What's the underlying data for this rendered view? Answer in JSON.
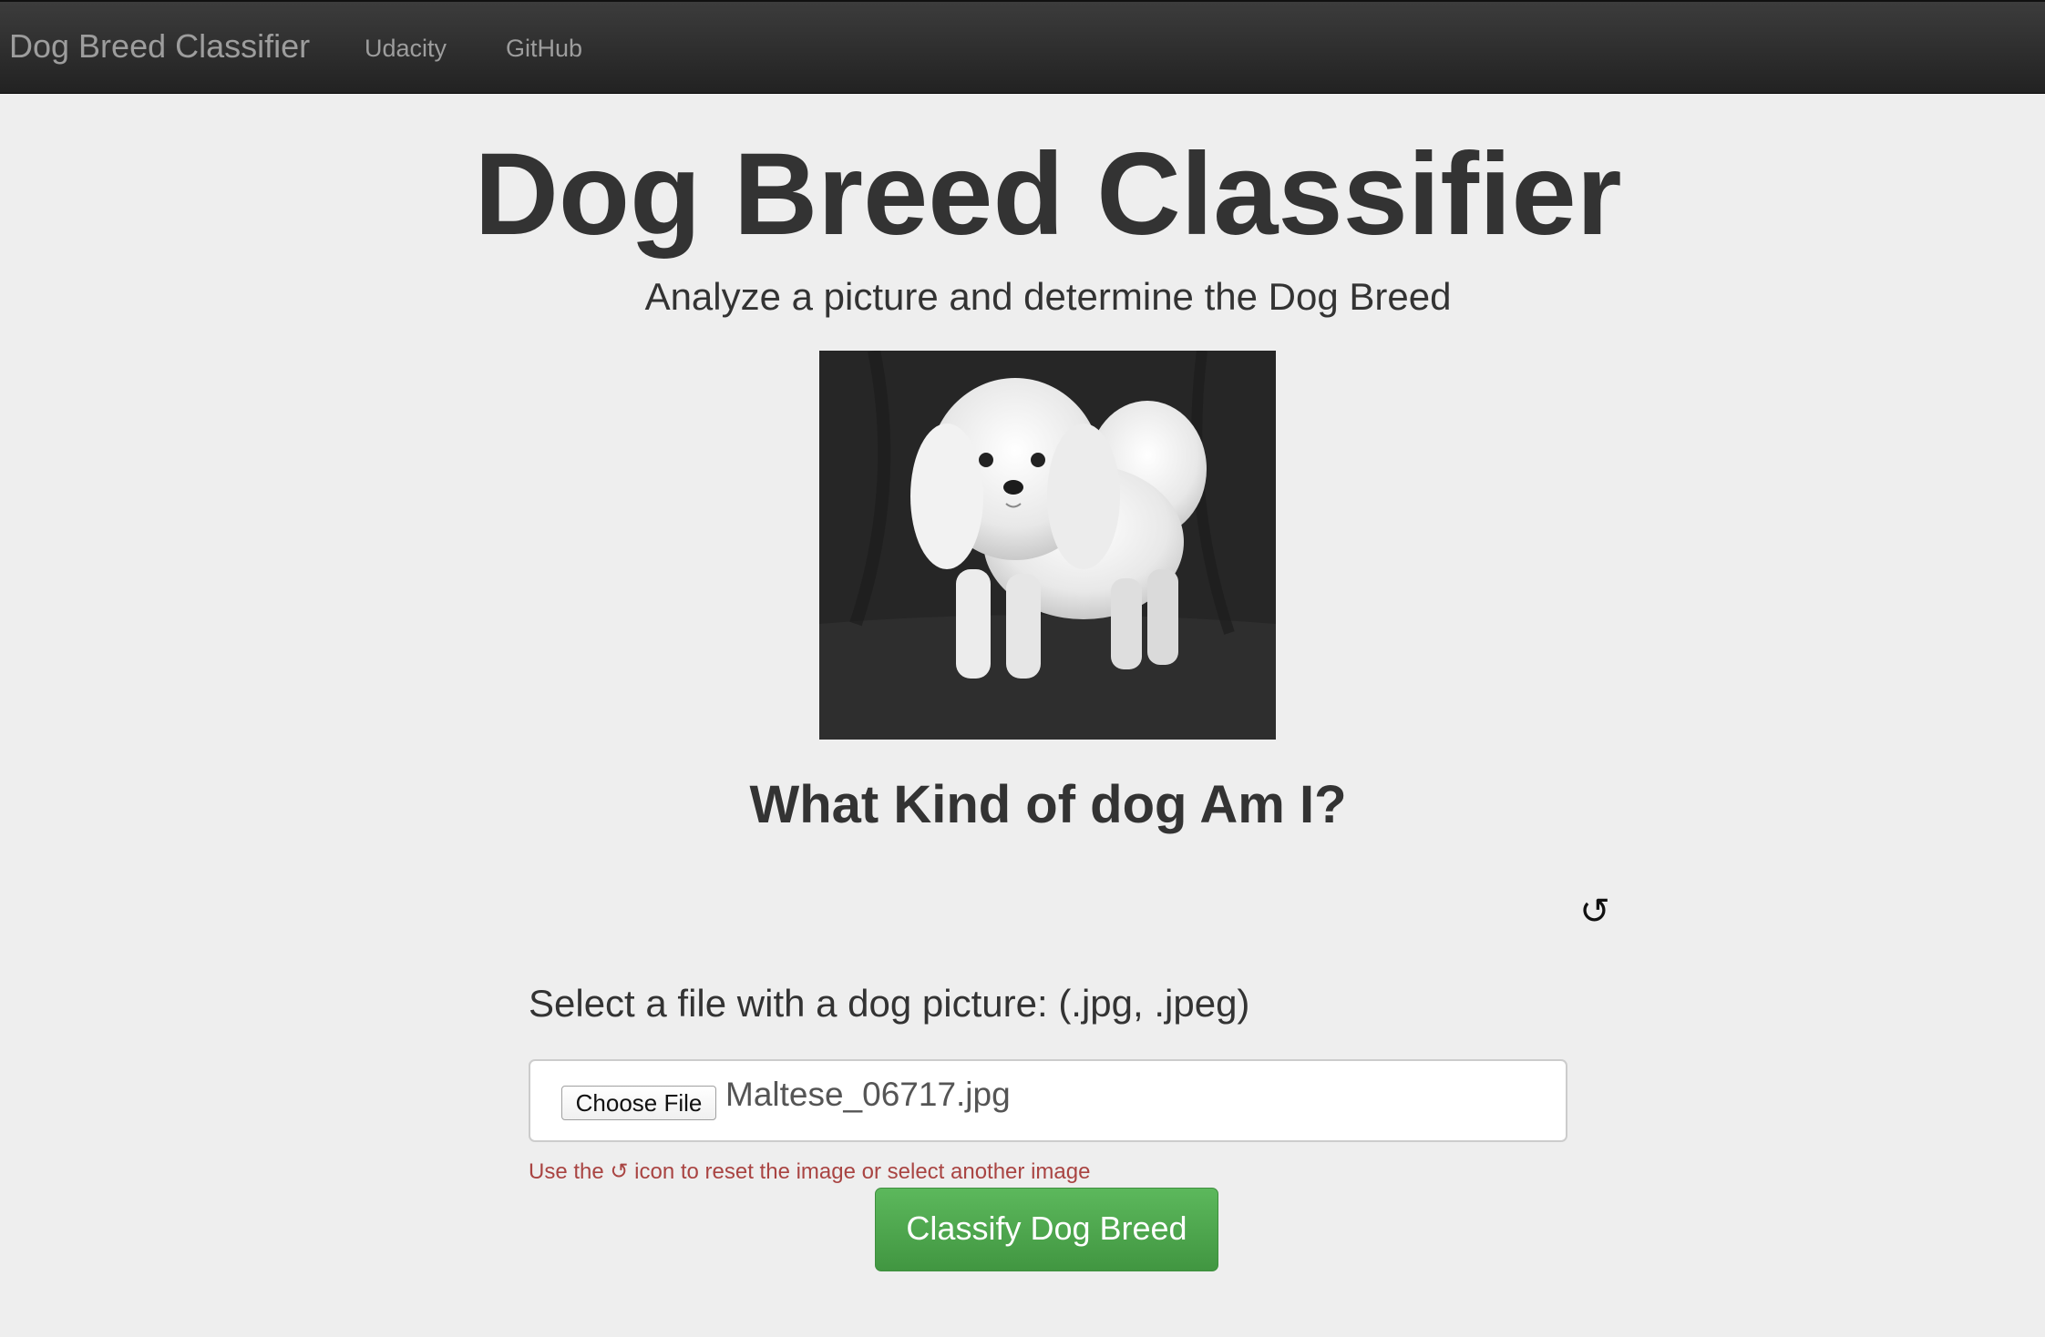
{
  "navbar": {
    "brand": "Dog Breed Classifier",
    "links": [
      "Udacity",
      "GitHub"
    ]
  },
  "main": {
    "title": "Dog Breed Classifier",
    "subtitle": "Analyze a picture and determine the Dog Breed",
    "image_description": "white fluffy dog on black backdrop",
    "question": "What Kind of dog Am I?",
    "reset_icon": "reset-icon",
    "file_label": "Select a file with a dog picture: (.jpg, .jpeg)",
    "choose_button": "Choose File",
    "file_name": "Maltese_06717.jpg",
    "help_text": "Use the ↺ icon to reset the image or select another image",
    "classify_button": "Classify Dog Breed"
  },
  "colors": {
    "navbar": "#222222",
    "background": "#eeeeee",
    "button_green": "#5cb85c",
    "help_red": "#a94442"
  }
}
